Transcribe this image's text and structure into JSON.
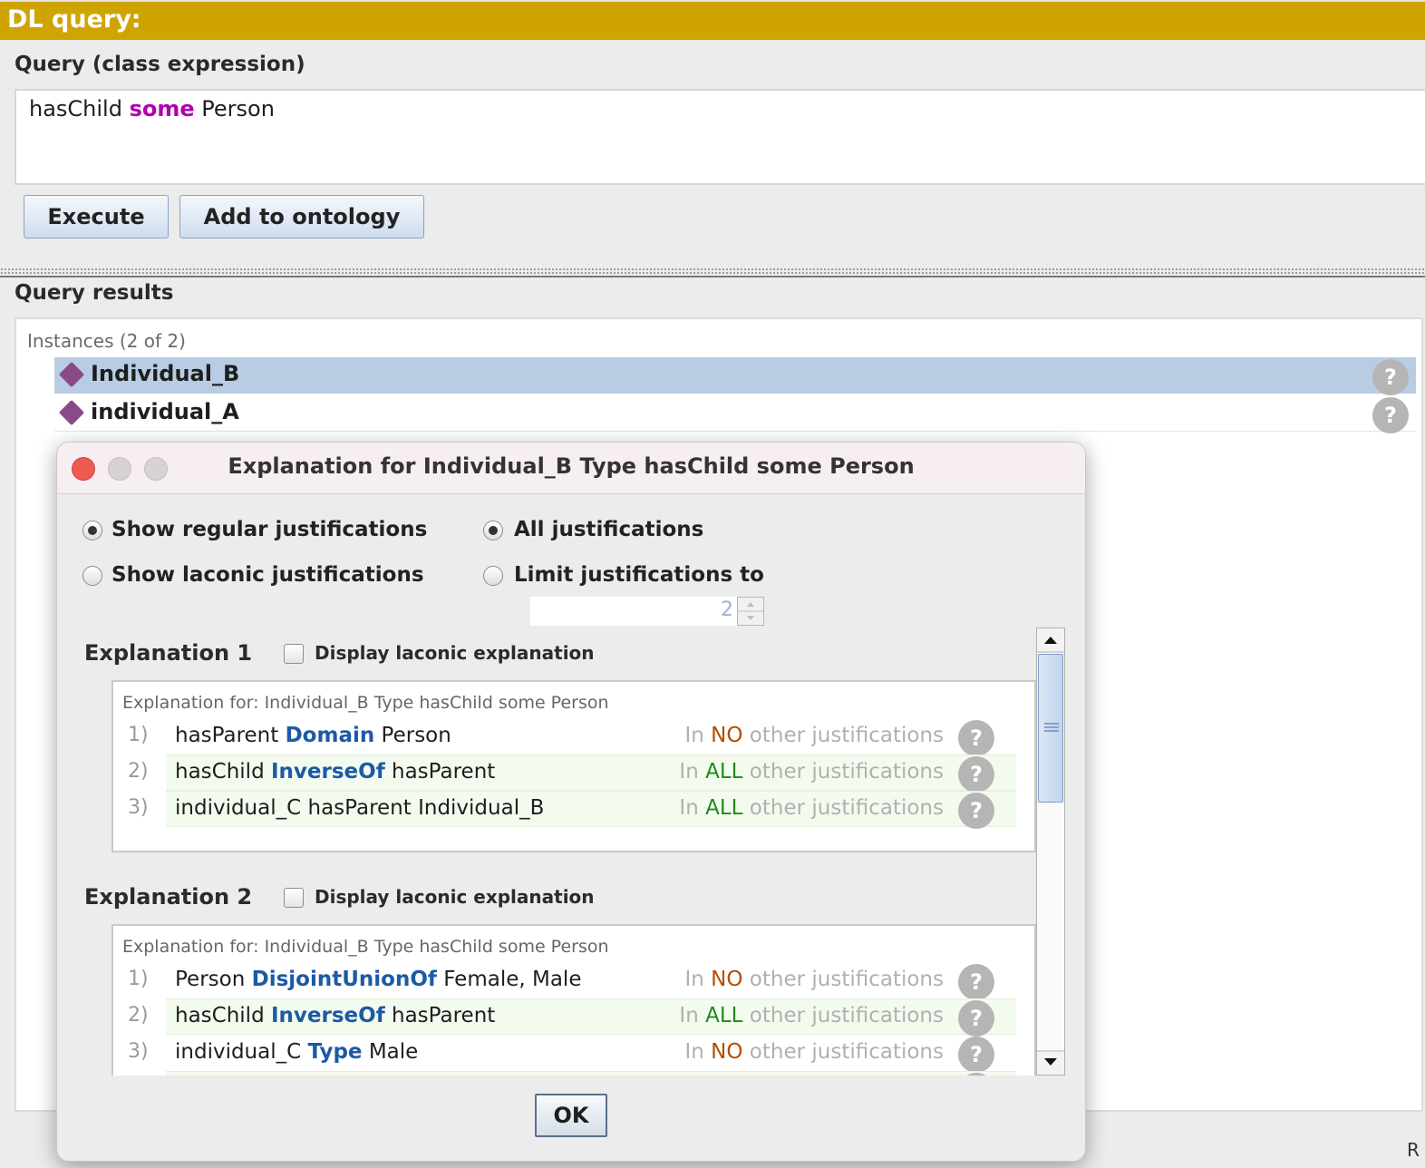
{
  "panel_title": "DL query:",
  "query": {
    "label": "Query (class expression)",
    "text_part1": "hasChild ",
    "text_keyword": "some",
    "text_part2": " Person"
  },
  "buttons": {
    "execute": "Execute",
    "add_to_ontology": "Add to ontology"
  },
  "results": {
    "label": "Query results",
    "instances_header": "Instances (2 of 2)",
    "items": [
      {
        "name": "Individual_B",
        "selected": true
      },
      {
        "name": "individual_A",
        "selected": false
      }
    ],
    "help_glyph": "?"
  },
  "edge_text": "R",
  "dialog": {
    "title": "Explanation for Individual_B Type hasChild some Person",
    "options": {
      "show_regular": "Show regular justifications",
      "show_laconic": "Show laconic justifications",
      "all_justifications": "All justifications",
      "limit_to": "Limit justifications to",
      "limit_value": "2"
    },
    "explanations": [
      {
        "title": "Explanation 1",
        "checkbox_label": "Display laconic explanation",
        "for_text": "Explanation for: Individual_B Type hasChild some Person",
        "axioms": [
          {
            "num": "1)",
            "pre": "hasParent ",
            "kw": "Domain",
            "post": " Person",
            "in": "In ",
            "scope": "NO",
            "rest": " other justifications"
          },
          {
            "num": "2)",
            "pre": "hasChild ",
            "kw": "InverseOf",
            "post": " hasParent",
            "in": "In ",
            "scope": "ALL",
            "rest": " other justifications"
          },
          {
            "num": "3)",
            "pre": "individual_C hasParent Individual_B",
            "kw": "",
            "post": "",
            "in": "In ",
            "scope": "ALL",
            "rest": " other justifications"
          }
        ]
      },
      {
        "title": "Explanation 2",
        "checkbox_label": "Display laconic explanation",
        "for_text": "Explanation for: Individual_B Type hasChild some Person",
        "axioms": [
          {
            "num": "1)",
            "pre": "Person ",
            "kw": "DisjointUnionOf",
            "post": " Female, Male",
            "in": "In ",
            "scope": "NO",
            "rest": " other justifications"
          },
          {
            "num": "2)",
            "pre": "hasChild ",
            "kw": "InverseOf",
            "post": " hasParent",
            "in": "In ",
            "scope": "ALL",
            "rest": " other justifications"
          },
          {
            "num": "3)",
            "pre": "individual_C ",
            "kw": "Type",
            "post": " Male",
            "in": "In ",
            "scope": "NO",
            "rest": " other justifications"
          }
        ]
      }
    ],
    "ok_label": "OK"
  },
  "colors": {
    "title_bar": "#cfa400",
    "selection": "#b8cde4",
    "keyword_blue": "#1c5aa5",
    "keyword_purple": "#b000b0",
    "no_color": "#b34d00",
    "all_color": "#208a1e",
    "close_button": "#ee5a52"
  }
}
